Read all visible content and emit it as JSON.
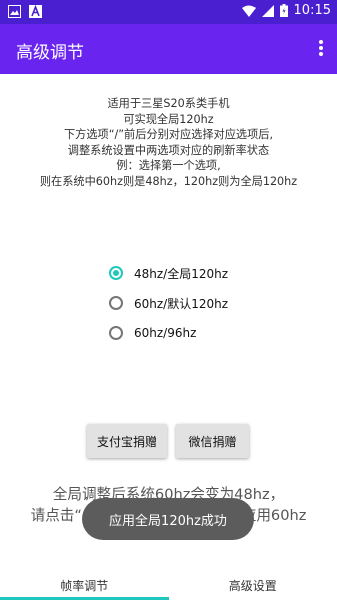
{
  "status_bar": {
    "time": "10:15",
    "icons": [
      "image-icon",
      "text-icon",
      "wifi-icon",
      "signal-icon",
      "battery-icon"
    ]
  },
  "app_bar": {
    "title": "高级调节",
    "menu_icon": "overflow-menu-icon",
    "background": "#6a24f0"
  },
  "description": {
    "lines": [
      "适用于三星S20系类手机",
      "可实现全局120hz",
      "下方选项“/”前后分别对应选择对应选项后,",
      "调整系统设置中两选项对应的刷新率状态",
      "例：选择第一个选项,",
      "则在系统中60hz则是48hz，120hz则为全局120hz"
    ]
  },
  "radio_options": [
    {
      "label": "48hz/全局120hz",
      "checked": true
    },
    {
      "label": "60hz/默认120hz",
      "checked": false
    },
    {
      "label": "60hz/96hz",
      "checked": false
    }
  ],
  "buttons": {
    "alipay": "支付宝捐赠",
    "wechat": "微信捐赠"
  },
  "notice": {
    "line1": "全局调整后系统60hz会变为48hz，",
    "line2": "请点击“60hz”后即可生效，点击应用60hz"
  },
  "toast": "应用全局120hz成功",
  "tabs": [
    {
      "label": "帧率调节",
      "active": true
    },
    {
      "label": "高级设置",
      "active": false
    }
  ],
  "colors": {
    "accent": "#1fc7bd",
    "status_bar": "#4a1fd0",
    "app_bar": "#6a24f0"
  }
}
